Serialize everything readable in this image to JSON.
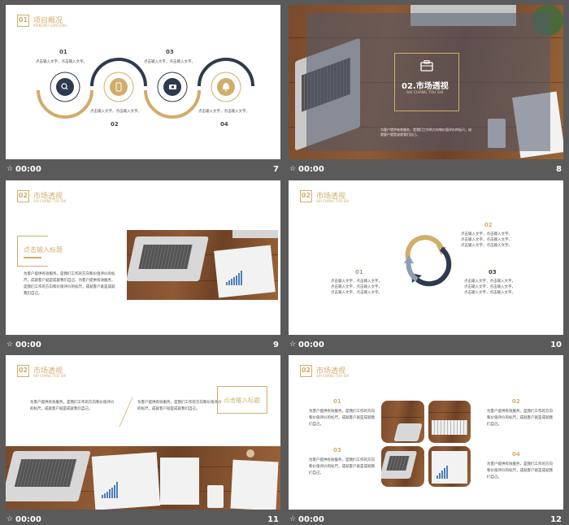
{
  "slides": [
    {
      "number": "7",
      "time": "00:00",
      "header": {
        "num": "01",
        "title": "项目概况",
        "subtitle": "XIANGMU GAIKUANG"
      },
      "steps": [
        {
          "label": "01",
          "text1": "点击输入文字，",
          "text2": "点击输入文字。",
          "icon": "search-icon"
        },
        {
          "label": "02",
          "text1": "点击输入文字，",
          "text2": "点击输入文字。",
          "icon": "phone-icon"
        },
        {
          "label": "03",
          "text1": "点击输入文字，",
          "text2": "点击输入文字。",
          "icon": "camera-icon"
        },
        {
          "label": "04",
          "text1": "点击输入文字，",
          "text2": "点击输入文字。",
          "icon": "bell-icon"
        }
      ]
    },
    {
      "number": "8",
      "time": "00:00",
      "title": "02.市场透视",
      "subtitle": "SHI CHANG TOU SHI",
      "caption": "为客户提供有效服务，是我们工作的方向和价值评价的标尺，成就客户就是成就我们自己。"
    },
    {
      "number": "9",
      "time": "00:00",
      "header": {
        "num": "02",
        "title": "市场透视",
        "subtitle": "SHI CHANG TOU SHI"
      },
      "heading": "点击输入标题",
      "paragraph": "为客户提供有效服务，是我们工作的方向和价值评价的标尺，成就客户就是成就我们自己。为客户提供有效服务，是我们工作的方向和价值评价的标尺，成就客户就是成就我们自己。"
    },
    {
      "number": "10",
      "time": "00:00",
      "header": {
        "num": "02",
        "title": "市场透视",
        "subtitle": "SHI CHANG TOU SHI"
      },
      "items": [
        {
          "label": "01",
          "lines": [
            "点击输入文字，点击输入文字，",
            "点击输入文字，点击输入文字，",
            "点击输入文字，点击输入文字。"
          ]
        },
        {
          "label": "02",
          "lines": [
            "点击输入文字，点击输入文字，",
            "点击输入文字，点击输入文字，",
            "点击输入文字，点击输入文字。"
          ]
        },
        {
          "label": "03",
          "lines": [
            "点击输入文字，点击输入文字，",
            "点击输入文字，点击输入文字，",
            "点击输入文字，点击输入文字。"
          ]
        }
      ]
    },
    {
      "number": "11",
      "time": "00:00",
      "header": {
        "num": "02",
        "title": "市场透视",
        "subtitle": "SHI CHANG TOU SHI"
      },
      "heading": "点击输入标题",
      "para1": "为客户提供有效服务，是我们工作的方向和价值评价的标尺，成就客户就是成就我们自己。",
      "para2": "为客户提供有效服务，是我们工作的方向和价值评价的标尺，成就客户就是成就我们自己。"
    },
    {
      "number": "12",
      "time": "00:00",
      "header": {
        "num": "02",
        "title": "市场透视",
        "subtitle": "SHI CHANG TOU SHI"
      },
      "blocks": [
        {
          "label": "01",
          "text": "为客户提供有效服务，是我们工作的方向和价值评价的标尺，成就客户就是成就我们自己。"
        },
        {
          "label": "02",
          "text": "为客户提供有效服务，是我们工作的方向和价值评价的标尺，成就客户就是成就我们自己。"
        },
        {
          "label": "03",
          "text": "为客户提供有效服务，是我们工作的方向和价值评价的标尺，成就客户就是成就我们自己。"
        },
        {
          "label": "04",
          "text": "为客户提供有效服务，是我们工作的方向和价值评价的标尺，成就客户就是成就我们自己。"
        }
      ]
    }
  ],
  "footer_icon": "animation-icon",
  "colors": {
    "accent_gold": "#d1ad6a",
    "dark_navy": "#2e3a4f",
    "steel_blue": "#8d9db5",
    "background": "#5a5a5a"
  }
}
